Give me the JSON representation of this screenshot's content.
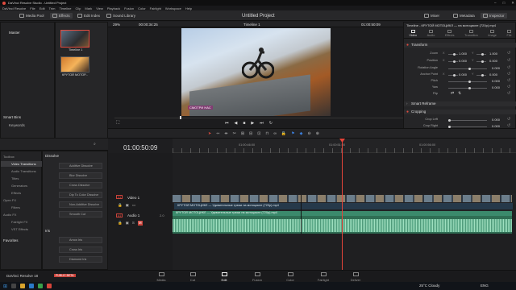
{
  "window": {
    "title": "DaVinci Resolve Studio - Untitled Project"
  },
  "menu": [
    "DaVinci Resolve",
    "File",
    "Edit",
    "Trim",
    "Timeline",
    "Clip",
    "Mark",
    "View",
    "Playback",
    "Fusion",
    "Color",
    "Fairlight",
    "Workspace",
    "Help"
  ],
  "toolbar": {
    "media_pool": "Media Pool",
    "effects": "Effects",
    "edit_index": "Edit Index",
    "sound_library": "Sound Library",
    "project_title": "Untitled Project",
    "mixer": "Mixer",
    "metadata": "Metadata",
    "inspector": "Inspector"
  },
  "viewer_bar": {
    "zoom": "29%",
    "source_tc": "00:00:34:25",
    "timeline_name": "Timeline 1",
    "record_tc": "01:00:50:09"
  },
  "bins": {
    "master": "Master",
    "smart_bins": "Smart Bins",
    "keywords": "Keywords"
  },
  "media_pool": {
    "clips": [
      {
        "label": "Timeline 1"
      },
      {
        "label": "КРУТОЙ МОТОР..."
      }
    ]
  },
  "viewer": {
    "watermark": "СМОТРИ НАС"
  },
  "inspector": {
    "header": "Timeline - КРУТОЙ МОТОЦИКЛ — на мотоцикле (720p).mp4",
    "tabs": [
      "Video",
      "Audio",
      "Effects",
      "Transition",
      "Image",
      "File"
    ],
    "transform_title": "Transform",
    "rows": [
      {
        "label": "Zoom",
        "a_label": "X",
        "a": "1.000",
        "b_label": "Y",
        "b": "1.000"
      },
      {
        "label": "Position",
        "a_label": "X",
        "a": "0.000",
        "b_label": "Y",
        "b": "0.000"
      },
      {
        "label": "Rotation Angle",
        "a": "0.000"
      },
      {
        "label": "Anchor Point",
        "a_label": "X",
        "a": "0.000",
        "b_label": "Y",
        "b": "0.000"
      },
      {
        "label": "Pitch",
        "a": "0.000"
      },
      {
        "label": "Yaw",
        "a": "0.000"
      },
      {
        "label": "Flip"
      }
    ],
    "smart_reframe": "Smart Reframe",
    "cropping_title": "Cropping",
    "crop_rows": [
      {
        "label": "Crop Left",
        "a": "0.000"
      },
      {
        "label": "Crop Right",
        "a": "0.000"
      }
    ]
  },
  "toolbox": {
    "items": [
      "Toolbox",
      "Video Transitions",
      "Audio Transitions",
      "Titles",
      "Generators",
      "Effects",
      "Open FX",
      "Filters",
      "Audio FX",
      "Fairlight FX",
      "VST Effects"
    ],
    "favorites": "Favorites"
  },
  "effects": {
    "section1": "Dissolve",
    "items1": [
      "Additive Dissolve",
      "Blur Dissolve",
      "Cross Dissolve",
      "Dip To Color Dissolve",
      "Non-Additive Dissolve",
      "Smooth Cut"
    ],
    "section2": "Iris",
    "items2": [
      "Arrow Iris",
      "Cross Iris",
      "Diamond Iris"
    ]
  },
  "timeline": {
    "timecode": "01:00:50:09",
    "ruler": [
      "01:00:46:00",
      "01:00:51:00",
      "01:00:56:00"
    ],
    "video_track": {
      "id": "V1",
      "name": "Video 1"
    },
    "audio_track": {
      "id": "A1",
      "name": "Audio 1",
      "level": "2.0"
    },
    "video_clip": "КРУТОЙ МОТОЦИКЛ — Удивительные трюки на мотоцикле (720p).mp4",
    "audio_clip": "КРУТОЙ МОТОЦИКЛ — Удивительные трюки на мотоцикле (720p).mp4"
  },
  "pages": [
    "Media",
    "Cut",
    "Edit",
    "Fusion",
    "Color",
    "Fairlight",
    "Deliver"
  ],
  "app_footer": {
    "name": "DaVinci Resolve 18",
    "badge": "PUBLIC BETA"
  },
  "taskbar": {
    "weather": "25°C  Cloudy",
    "lang": "ENG"
  },
  "colors": {
    "accent": "#e14b3f",
    "playhead": "#e5443a",
    "video_clip": "#2a3d4d",
    "audio_clip": "#2f6e54"
  }
}
